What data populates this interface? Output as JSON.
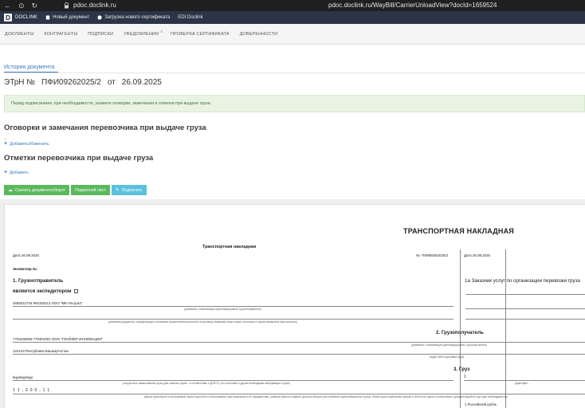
{
  "browser": {
    "host": "pdoc.doclink.ru",
    "url": "pdoc.doclink.ru/WayBill/CarrierUnloadView?docId=1659524"
  },
  "app": {
    "logo": "D",
    "name": "DOCLINK",
    "new_doc": "Новый документ",
    "upload_cert": "Загрузка нового сертификата",
    "edi": "EDI.Doclink"
  },
  "menu": {
    "items": [
      "ДОКУМЕНТЫ",
      "КОНТРАГЕНТЫ",
      "ПОДПИСКИ",
      "УВЕДОМЛЕНИЯ",
      "ПРОВЕРКА СЕРТИФИКАТА",
      "ДОВЕРЕННОСТИ"
    ],
    "notifications_badge": "0"
  },
  "main": {
    "history_tab": "История документа",
    "doc_type": "ЭТрН №",
    "doc_number": "ПФИ09262025/2",
    "doc_from": "от",
    "doc_date": "26.09.2025",
    "alert": "Перед подписанием, при необходимости, укажите оговорки, замечания и отметки при выдаче груза.",
    "section1_title": "Оговорки и замечания перевозчика при выдаче груза",
    "section1_link": "Добавить/Изменить",
    "section2_title": "Отметки перевозчика при выдаче груза",
    "section2_link": "Добавить",
    "btn_download": "Скачать документооборот",
    "btn_sign_sheet": "Подписной лист",
    "btn_sign": "Подписать"
  },
  "doc": {
    "big_title": "ТРАНСПОРТНАЯ НАКЛАДНАЯ",
    "mid_title": "Транспортная накладная",
    "date_label": "Дата",
    "date_value": "26.09.2025",
    "num_label": "№",
    "num_value": "ПФИ09262025/2",
    "date_right_label": "Дата",
    "date_right_value": "26.09.2025",
    "copy_no": "Экземпляр №:",
    "s1": "1. Грузоотправитель",
    "s1_forwarder": "является экспедитором",
    "shipper_line": "4605512718 994150112 ООО \"МК-УльтраЗ\"",
    "cap_requisites": "(реквизиты, позволяющие идентифицировать Грузоотправителя)",
    "cap_doc": "(реквизиты документа, определяющего основания осуществления расчетов по договору перевозки иным лицом, отличным от грузоотправителя (при наличии))",
    "s1a": "1а Заказчик услуг по организации перевозки груза",
    "s2": "2. Грузополучатель",
    "consignee_line": "7703166658 770301001 ООО \"ГФАЙЗЕР ИННОВАЦИИ\"",
    "cap_consignee": "(реквизиты, позволяющие идентифицировать Грузополучателя)",
    "address": "123123 Республика Башкортостан",
    "cap_address": "(адрес места доставки груза)",
    "s3": "3. Груз",
    "s3_value": "1",
    "cargo_name": "йцукйцуйцук",
    "cap_cargo": "(отгрузочное наименование груза (для опасных грузов - в соответствии с ДОПОГ), его состояние и другая необходимая информация о грузе)",
    "cargo_counts": "1 1 , 0 0 0 , 1 1",
    "cap_weight": "(масса груза брутто в килограммах, масса груза нетто в килограммах (при возможности ее определения), размеры (высота, ширина, длина) в метрах (при перевозке крупногабаритного груза), объем груза в кубических метрах и плотность груза в соответствии с документацией на груз (при необходимости))",
    "right_bottom": "1 Российский рубль",
    "right_cap": "(идентифи..."
  }
}
